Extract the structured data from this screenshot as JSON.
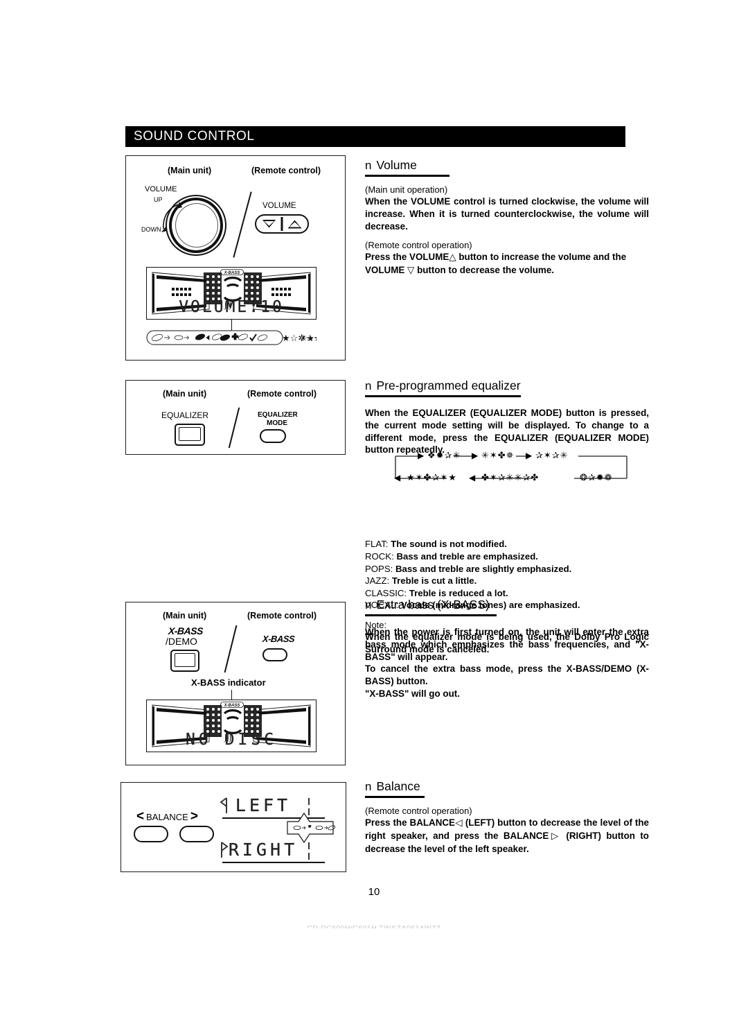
{
  "document": {
    "section_title": "SOUND CONTROL",
    "page_number": "10",
    "footer_faint": "CD-DC600H/C601H TINSZA061AWZZ"
  },
  "figures": {
    "volume": {
      "caption_main": "(Main unit)",
      "caption_remote": "(Remote control)",
      "knob_label": "VOLUME",
      "knob_up": "UP",
      "knob_down": "DOWN",
      "remote_label": "VOLUME",
      "display_text": "VOLUME:10"
    },
    "equalizer": {
      "caption_main": "(Main unit)",
      "caption_remote": "(Remote control)",
      "main_button_label": "EQUALIZER",
      "remote_button_line1": "EQUALIZER",
      "remote_button_line2": "MODE"
    },
    "xbass": {
      "caption_main": "(Main unit)",
      "caption_remote": "(Remote control)",
      "main_button_line1": "X-BASS",
      "main_button_line2": "/DEMO",
      "remote_button_label": "X-BASS",
      "indicator_label": "X-BASS indicator",
      "display_text": "NO DISC",
      "display_badge": "X-BASS"
    },
    "balance": {
      "button_label": "BALANCE",
      "left_chevron": "<",
      "right_chevron": ">",
      "display_left": "LEFT",
      "display_right": "RIGHT"
    }
  },
  "topics": [
    {
      "id": "volume",
      "bullet": "n",
      "title": "Volume",
      "blocks": [
        {
          "kind": "sub",
          "text": "(Main unit operation)"
        },
        {
          "kind": "body",
          "text": "When the VOLUME control is turned clockwise, the volume will increase. When it is turned counterclockwise, the volume will decrease."
        },
        {
          "kind": "sub",
          "text": "(Remote control operation)"
        },
        {
          "kind": "body_sym",
          "text_a": "Press the VOLUME",
          "sym_a": "△",
          "text_b": "button to increase the volume and the VOLUME",
          "sym_b": "▽",
          "text_c": "button to decrease the volume."
        }
      ]
    },
    {
      "id": "equalizer",
      "bullet": "n",
      "title": "Pre-programmed equalizer",
      "blocks": [
        {
          "kind": "body",
          "text": "When the EQUALIZER (EQUALIZER MODE) button is pressed, the current mode setting will be displayed. To change to a different mode, press the EQUALIZER (EQUALIZER MODE) button repeatedly."
        }
      ]
    },
    {
      "id": "xbass",
      "bullet": "n",
      "title": "Extra bass (X-BASS)",
      "blocks": [
        {
          "kind": "body",
          "text": "When the power is first turned on, the unit will enter the extra bass mode which emphasizes the bass frequencies, and \"X-BASS\" will appear."
        },
        {
          "kind": "body",
          "text": "To cancel the extra bass mode, press the X-BASS/DEMO (X-BASS) button."
        },
        {
          "kind": "body",
          "text": "\"X-BASS\" will go out."
        }
      ]
    },
    {
      "id": "balance",
      "bullet": "n",
      "title": "Balance",
      "blocks": [
        {
          "kind": "sub",
          "text": "(Remote control operation)"
        },
        {
          "kind": "body_bal",
          "text_a": "Press the BALANCE",
          "sym_a": "◁",
          "text_b": "(LEFT) button to decrease the level of the right speaker, and press the BALANCE",
          "sym_b": "▷",
          "text_c": "(RIGHT) button to decrease the level of the left speaker."
        }
      ]
    }
  ],
  "eq_flow": {
    "modes_top": [
      "❖✹✰✳",
      "✳✶✤✵",
      "✰✶✰✳"
    ],
    "modes_bottom": [
      "★✶✤✰✶★",
      "✤✶✰✳✳✰✤",
      "❂✰✹❁"
    ],
    "arrow_right": "▶",
    "arrow_left": "◀"
  },
  "eq_modes": [
    {
      "name": "FLAT:",
      "desc": "The sound is not modified."
    },
    {
      "name": "ROCK:",
      "desc": "Bass and treble are emphasized."
    },
    {
      "name": "POPS:",
      "desc": "Bass and treble are slightly emphasized."
    },
    {
      "name": "JAZZ:",
      "desc": "Treble is cut a little."
    },
    {
      "name": "CLASSIC:",
      "desc": "Treble is reduced a lot."
    },
    {
      "name": "VOCAL:",
      "desc": "Vocals (midrange tones) are emphasized."
    }
  ],
  "eq_note": {
    "label": "Note:",
    "text": "When the equalizer mode is being used, the Dolby Pro Logic Surround mode is canceled."
  }
}
